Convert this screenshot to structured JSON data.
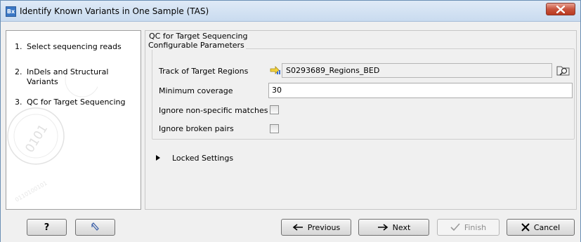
{
  "window": {
    "app_icon_text": "Bx",
    "title": "Identify Known Variants in One Sample (TAS)",
    "close_icon": "close-x-icon"
  },
  "steps": [
    {
      "number": "1.",
      "label": "Select sequencing reads"
    },
    {
      "number": "2.",
      "label": "InDels and Structural Variants"
    },
    {
      "number": "3.",
      "label": "QC for Target Sequencing"
    }
  ],
  "main": {
    "section_title": "QC for Target Sequencing",
    "group_title": "Configurable Parameters",
    "track": {
      "label": "Track of Target Regions",
      "value": "S0293689_Regions_BED",
      "browse_icon": "browse-folder-icon"
    },
    "min_coverage": {
      "label": "Minimum coverage",
      "value": "30"
    },
    "ignore_nonspecific": {
      "label": "Ignore non-specific matches",
      "checked": false
    },
    "ignore_broken": {
      "label": "Ignore broken pairs",
      "checked": false
    },
    "locked_settings": {
      "label": "Locked Settings",
      "expanded": false
    }
  },
  "buttons": {
    "help": "?",
    "reset_icon": "reset-icon",
    "previous": "Previous",
    "next": "Next",
    "finish": "Finish",
    "cancel": "Cancel"
  },
  "colors": {
    "titlebar": "#c9dbef",
    "close_button": "#c8543e",
    "background": "#f0f0f0"
  }
}
